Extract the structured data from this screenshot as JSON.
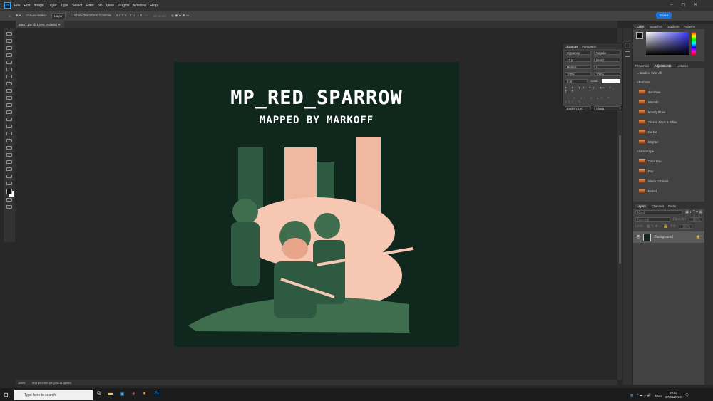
{
  "menu": [
    "File",
    "Edit",
    "Image",
    "Layer",
    "Type",
    "Select",
    "Filter",
    "3D",
    "View",
    "Plugins",
    "Window",
    "Help"
  ],
  "options": {
    "auto_select": "Auto-Select",
    "layer_select": "Layer",
    "show_transform": "Show Transform Controls",
    "mode_3d": "3D Mode",
    "share": "Share"
  },
  "document_tab": "sass1.jpg @ 100% (RGB/8)",
  "artwork": {
    "title": "MP_RED_SPARROW",
    "subtitle": "MAPPED BY MARKOFF",
    "background": "#0f271c"
  },
  "status": {
    "zoom": "100%",
    "dimensions": "804 px x 804 px (118.11 ppcm)"
  },
  "character": {
    "tabs": [
      "Character",
      "Paragraph"
    ],
    "font": "Gyparody",
    "style": "Regular",
    "size": "12 pt",
    "leading": "(Auto)",
    "kerning": "Metrics",
    "tracking": "0",
    "vscale": "100%",
    "hscale": "100%",
    "baseline": "0 pt",
    "color_label": "Color:",
    "language": "English: UK",
    "antialias": "Sharp"
  },
  "color_panel": {
    "tabs": [
      "Color",
      "Swatches",
      "Gradients",
      "Patterns"
    ]
  },
  "adjustments": {
    "tabs": [
      "Properties",
      "Adjustments",
      "Libraries"
    ],
    "back": "Back to view all",
    "groups": [
      {
        "name": "Portraits",
        "items": [
          "Sunshine",
          "Warmth",
          "Moody Blues",
          "Classic Black & White",
          "Darker",
          "Brighter"
        ]
      },
      {
        "name": "Landscape",
        "items": [
          "Color Pop",
          "Pop",
          "Warm Contrast",
          "Faded"
        ]
      }
    ]
  },
  "layers": {
    "tabs": [
      "Layers",
      "Channels",
      "Paths"
    ],
    "filter": "Kind",
    "blend": "Normal",
    "opacity_label": "Opacity:",
    "opacity": "100%",
    "lock_label": "Lock:",
    "fill_label": "Fill:",
    "fill": "100%",
    "layer_name": "Background"
  },
  "taskbar": {
    "search_placeholder": "Type here to search",
    "time": "09:33",
    "date": "27/01/2024",
    "lang": "ENG"
  }
}
